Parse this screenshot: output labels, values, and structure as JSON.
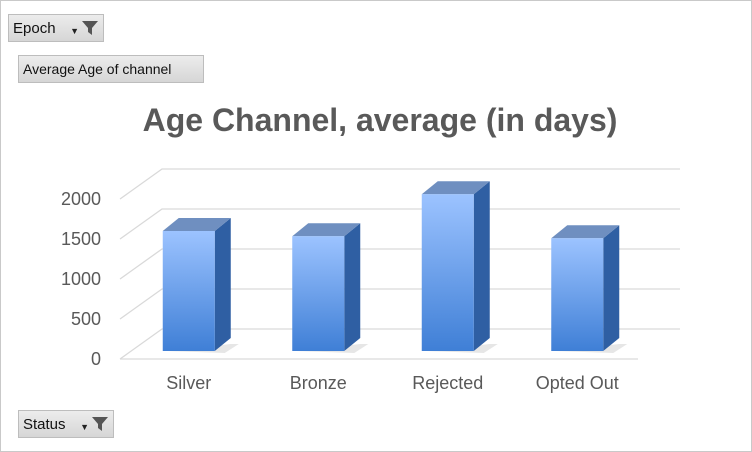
{
  "filters": {
    "report_filter": {
      "label": "Epoch",
      "icons": [
        "dropdown-arrow-icon",
        "filter-funnel-icon"
      ]
    },
    "value_field": {
      "label": "Average Age of channel"
    },
    "axis_field": {
      "label": "Status",
      "icons": [
        "dropdown-arrow-icon",
        "filter-funnel-icon"
      ]
    }
  },
  "colors": {
    "bar_front_top": "#9cc3ff",
    "bar_front_bottom": "#3f7fd6",
    "bar_side": "#2f5fa3",
    "bar_top": "#6f8fc0",
    "gridline": "#d9d9d9",
    "axis_text": "#595959",
    "title_text": "#595959"
  },
  "chart_data": {
    "type": "bar",
    "style": "3d-column",
    "title": "Age Channel, average (in days)",
    "xlabel": "",
    "ylabel": "",
    "categories": [
      "Silver",
      "Bronze",
      "Rejected",
      "Opted Out"
    ],
    "values": [
      1500,
      1435,
      1960,
      1410
    ],
    "ylim": [
      0,
      2000
    ],
    "yticks": [
      0,
      500,
      1000,
      1500,
      2000
    ],
    "grid": true,
    "legend": "none"
  }
}
